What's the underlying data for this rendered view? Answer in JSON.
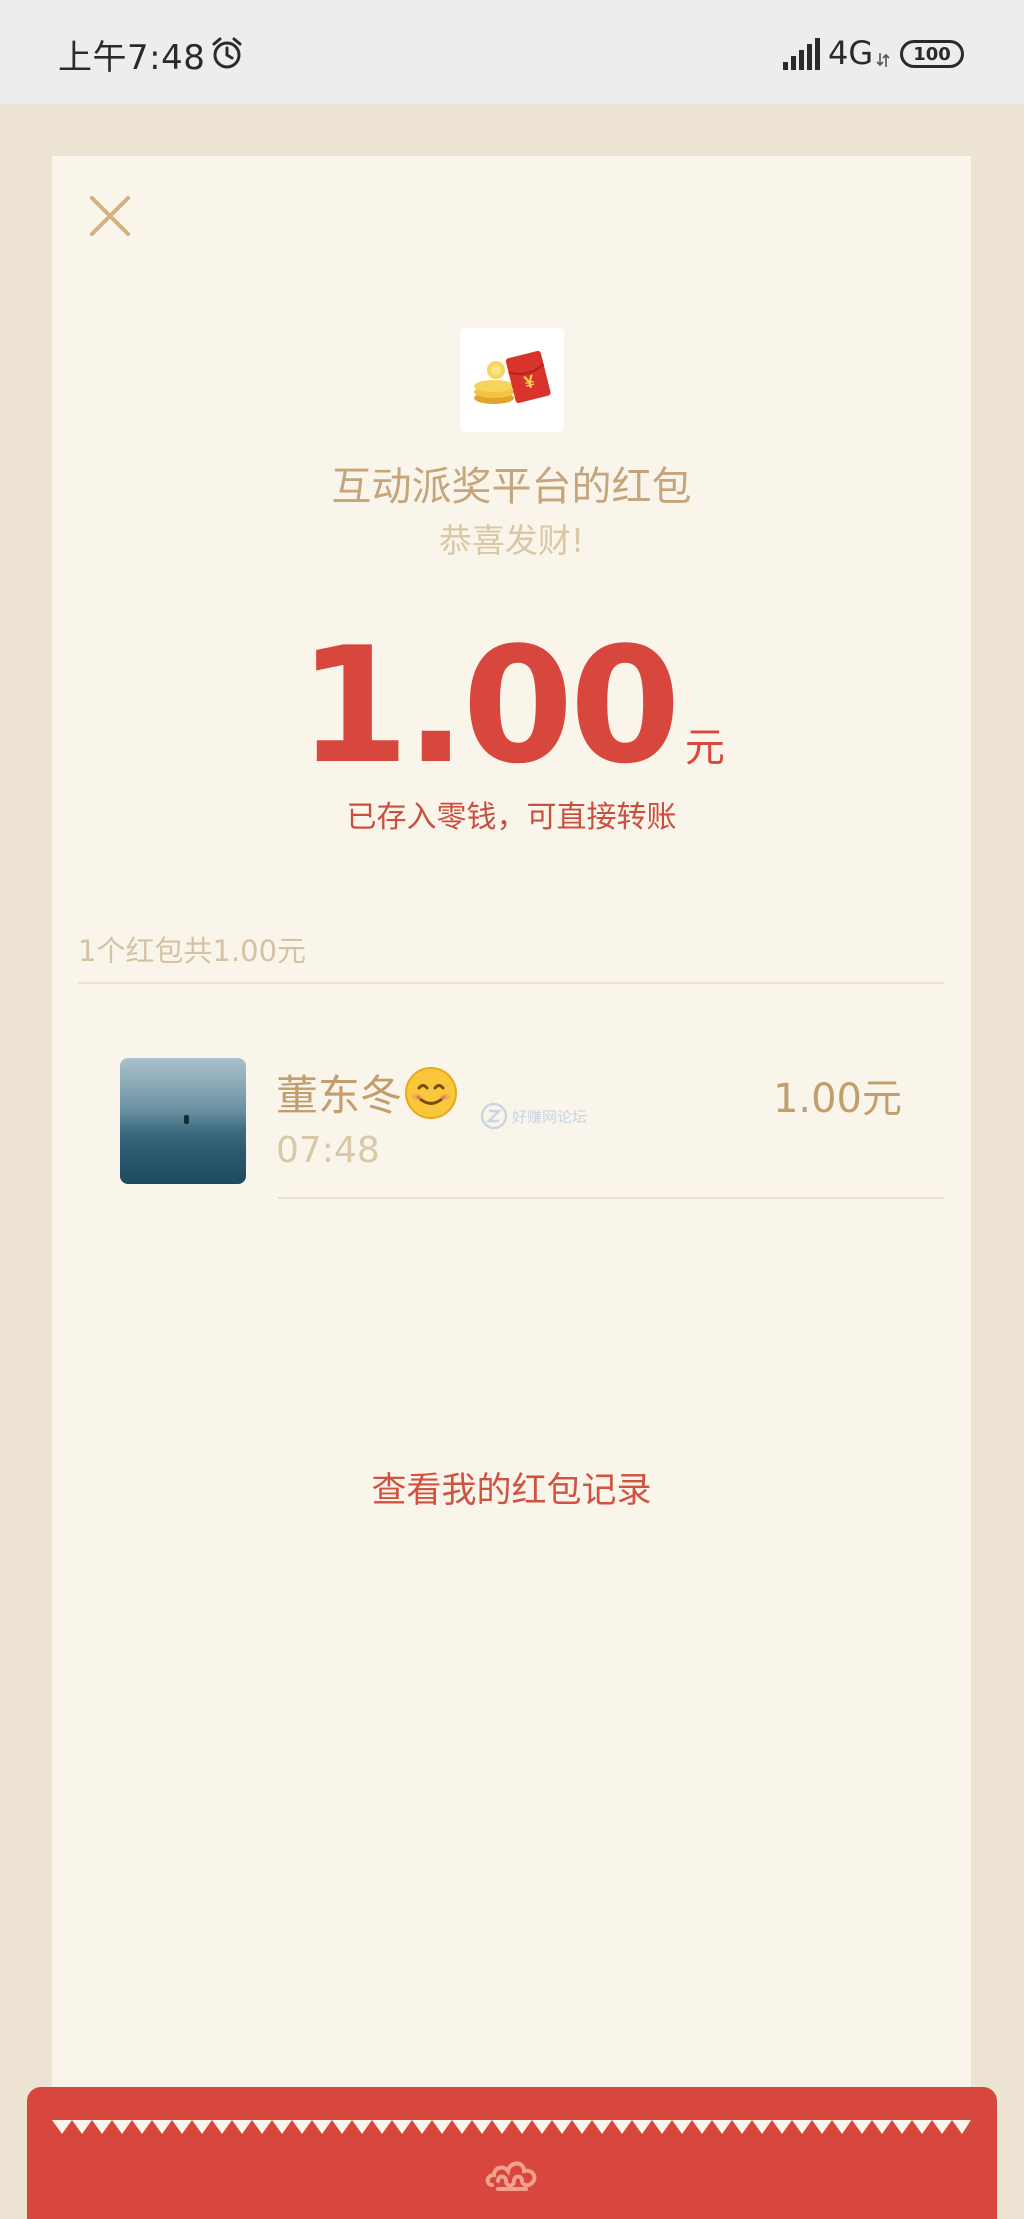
{
  "status_bar": {
    "time": "上午7:48",
    "network": "4G",
    "battery": "100",
    "icons": [
      "alarm-icon",
      "signal-icon",
      "network-arrows-icon"
    ]
  },
  "header": {
    "close_icon": "close-icon",
    "sender_logo_icon": "red-envelope-coins-icon",
    "sender_name": "互动派奖平台的红包",
    "greeting": "恭喜发财!"
  },
  "amount": {
    "value": "1.00",
    "unit": "元",
    "note": "已存入零钱，可直接转账"
  },
  "summary": "1个红包共1.00元",
  "records": [
    {
      "name": "董东冬",
      "emoji_icon": "smiling-face-emoji-icon",
      "time": "07:48",
      "amount": "1.00元"
    }
  ],
  "watermark": "好赚网论坛",
  "link": {
    "view_records": "查看我的红包记录"
  },
  "colors": {
    "accent_red": "#d8473d",
    "gold_text": "#c29e6d",
    "card_bg": "#faf5ea",
    "page_bg": "#ece3d2"
  }
}
